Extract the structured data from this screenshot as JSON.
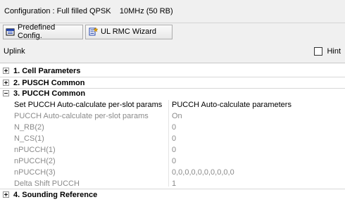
{
  "config": {
    "text": "Configuration : Full filled QPSK    10MHz (50 RB)"
  },
  "toolbar": {
    "predefined_label": "Predefined Config.",
    "wizard_label": "UL RMC Wizard"
  },
  "section": {
    "title": "Uplink"
  },
  "hint": {
    "label": "Hint",
    "checked": false
  },
  "categories": [
    {
      "label": "1. Cell Parameters",
      "expanded": false
    },
    {
      "label": "2. PUSCH Common",
      "expanded": false
    },
    {
      "label": "3. PUCCH Common",
      "expanded": true
    },
    {
      "label": "4. Sounding Reference",
      "expanded": false
    }
  ],
  "pucch_props": [
    {
      "name": "Set PUCCH Auto-calculate per-slot params",
      "value": "PUCCH Auto-calculate parameters",
      "enabled": true
    },
    {
      "name": "PUCCH Auto-calculate per-slot params",
      "value": "On",
      "enabled": false
    },
    {
      "name": "N_RB(2)",
      "value": "0",
      "enabled": false
    },
    {
      "name": "N_CS(1)",
      "value": "0",
      "enabled": false
    },
    {
      "name": "nPUCCH(1)",
      "value": "0",
      "enabled": false
    },
    {
      "name": "nPUCCH(2)",
      "value": "0",
      "enabled": false
    },
    {
      "name": "nPUCCH(3)",
      "value": "0,0,0,0,0,0,0,0,0,0",
      "enabled": false
    },
    {
      "name": "Delta Shift PUCCH",
      "value": "1",
      "enabled": false
    }
  ]
}
